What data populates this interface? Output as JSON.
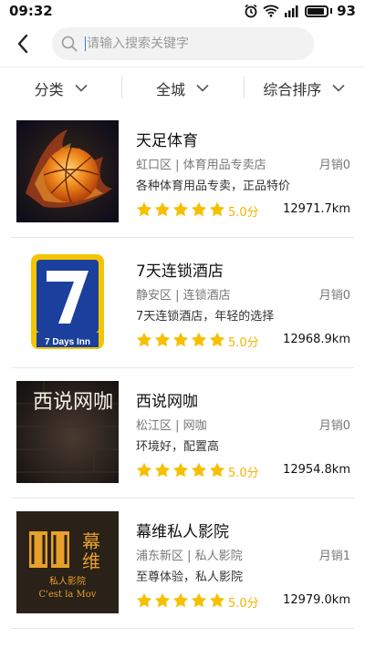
{
  "status": {
    "time": "09:32",
    "battery": "93"
  },
  "search": {
    "placeholder": "请输入搜索关键字"
  },
  "filters": [
    {
      "label": "分类"
    },
    {
      "label": "全城"
    },
    {
      "label": "综合排序"
    }
  ],
  "colors": {
    "star": "#f6c000",
    "score": "#f6b400",
    "divider": "#e8e8e8"
  },
  "items": [
    {
      "name": "天足体育",
      "meta": "虹口区 | 体育用品专卖店",
      "sales": "月销0",
      "desc": "各种体育用品专卖，正品特价",
      "rating": 5,
      "score": "5.0分",
      "distance": "12971.7km",
      "thumb_icon": "flaming-basketball-image"
    },
    {
      "name": "7天连锁酒店",
      "meta": "静安区 | 连锁酒店",
      "sales": "月销0",
      "desc": "7天连锁酒店，年轻的选择",
      "rating": 5,
      "score": "5.0分",
      "distance": "12968.9km",
      "thumb_icon": "7days-inn-logo",
      "logo_text": "7 Days Inn"
    },
    {
      "name": "西说网咖",
      "meta": "松江区 | 网咖",
      "sales": "月销0",
      "desc": "环境好，配置高",
      "rating": 5,
      "score": "5.0分",
      "distance": "12954.8km",
      "thumb_icon": "neon-sign-image",
      "sign_text": "西说网咖"
    },
    {
      "name": "幕维私人影院",
      "meta": "浦东新区 | 私人影院",
      "sales": "月销1",
      "desc": "至尊体验，私人影院",
      "rating": 5,
      "score": "5.0分",
      "distance": "12979.0km",
      "thumb_icon": "cinema-logo",
      "logo_text": [
        "幕",
        "维",
        "私人影院",
        "C'est la Mov"
      ]
    }
  ]
}
